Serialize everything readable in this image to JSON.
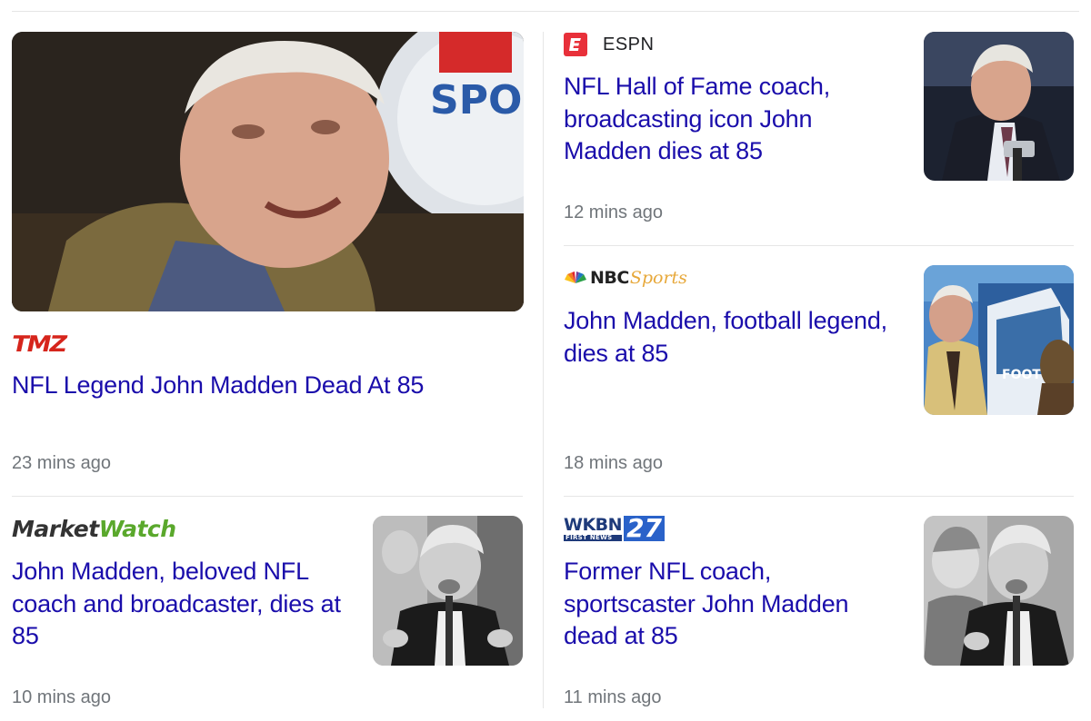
{
  "articles": [
    {
      "source": "TMZ",
      "headline": "NFL Legend John Madden Dead At 85",
      "time": "23 mins ago"
    },
    {
      "source": "ESPN",
      "headline": "NFL Hall of Fame coach, broadcasting icon John Madden dies at 85",
      "time": "12 mins ago"
    },
    {
      "source": "NBC Sports",
      "source_parts": {
        "nbc": "NBC",
        "sports": "Sports"
      },
      "headline": "John Madden, football legend, dies at 85",
      "time": "18 mins ago"
    },
    {
      "source": "MarketWatch",
      "source_parts": {
        "market": "Market",
        "watch": "Watch"
      },
      "headline": "John Madden, beloved NFL coach and broadcaster, dies at 85",
      "time": "10 mins ago"
    },
    {
      "source": "WKBN 27 First News",
      "source_parts": {
        "call": "WKBN",
        "sub": "FIRST NEWS",
        "num": "27"
      },
      "headline": "Former NFL coach, sportscaster John Madden dead at 85",
      "time": "11 mins ago"
    }
  ],
  "colors": {
    "headline": "#1a0dab",
    "timestamp": "#70757a",
    "divider": "#e6e6e6",
    "tmz": "#d6251c",
    "espn": "#e8303a",
    "marketwatch_green": "#5aa82c",
    "wkbn_blue": "#2a62c9"
  },
  "icons": [
    "espn-logo-icon",
    "nbc-peacock-icon"
  ]
}
